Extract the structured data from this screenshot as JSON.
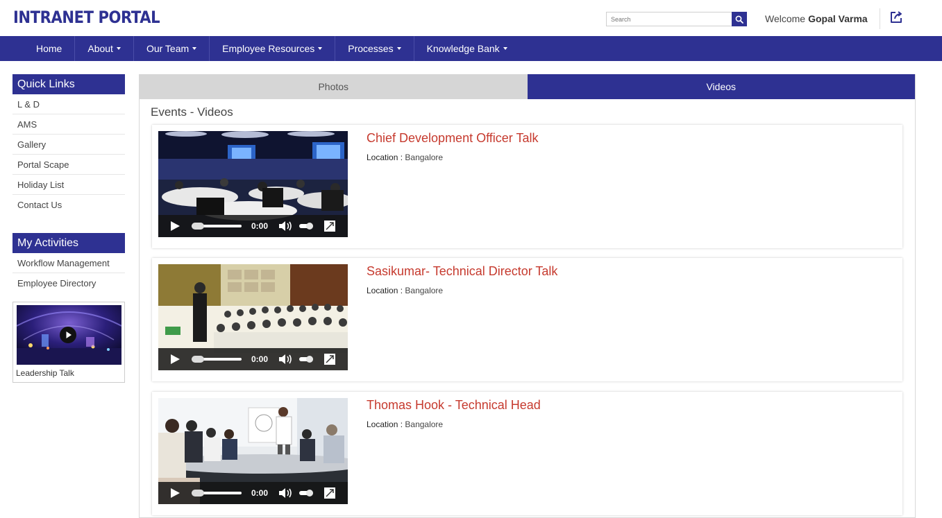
{
  "header": {
    "logo": "INTRANET PORTAL",
    "search_placeholder": "Search",
    "welcome_label": "Welcome",
    "user_name": "Gopal Varma"
  },
  "nav": {
    "items": [
      {
        "label": "Home",
        "dropdown": false
      },
      {
        "label": "About",
        "dropdown": true
      },
      {
        "label": "Our Team",
        "dropdown": true
      },
      {
        "label": "Employee Resources",
        "dropdown": true
      },
      {
        "label": "Processes",
        "dropdown": true
      },
      {
        "label": "Knowledge Bank",
        "dropdown": true
      }
    ]
  },
  "sidebar": {
    "quick_links_title": "Quick Links",
    "quick_links": [
      "L & D",
      "AMS",
      "Gallery",
      "Portal Scape",
      "Holiday List",
      "Contact Us"
    ],
    "activities_title": "My Activities",
    "activities": [
      "Workflow Management",
      "Employee Directory"
    ],
    "feature_caption": "Leadership Talk"
  },
  "tabs": {
    "photos": "Photos",
    "videos": "Videos",
    "active": "Videos"
  },
  "main": {
    "section_title": "Events - Videos",
    "videos": [
      {
        "title": "Chief Development Officer Talk",
        "location_label": "Location :",
        "location": "Bangalore",
        "time": "0:00"
      },
      {
        "title": "Sasikumar- Technical Director Talk",
        "location_label": "Location :",
        "location": "Bangalore",
        "time": "0:00"
      },
      {
        "title": "Thomas Hook - Technical Head",
        "location_label": "Location :",
        "location": "Bangalore",
        "time": "0:00"
      }
    ]
  },
  "colors": {
    "brand": "#2e3192",
    "title_red": "#c63a2e",
    "tab_inactive": "#d6d6d6"
  }
}
